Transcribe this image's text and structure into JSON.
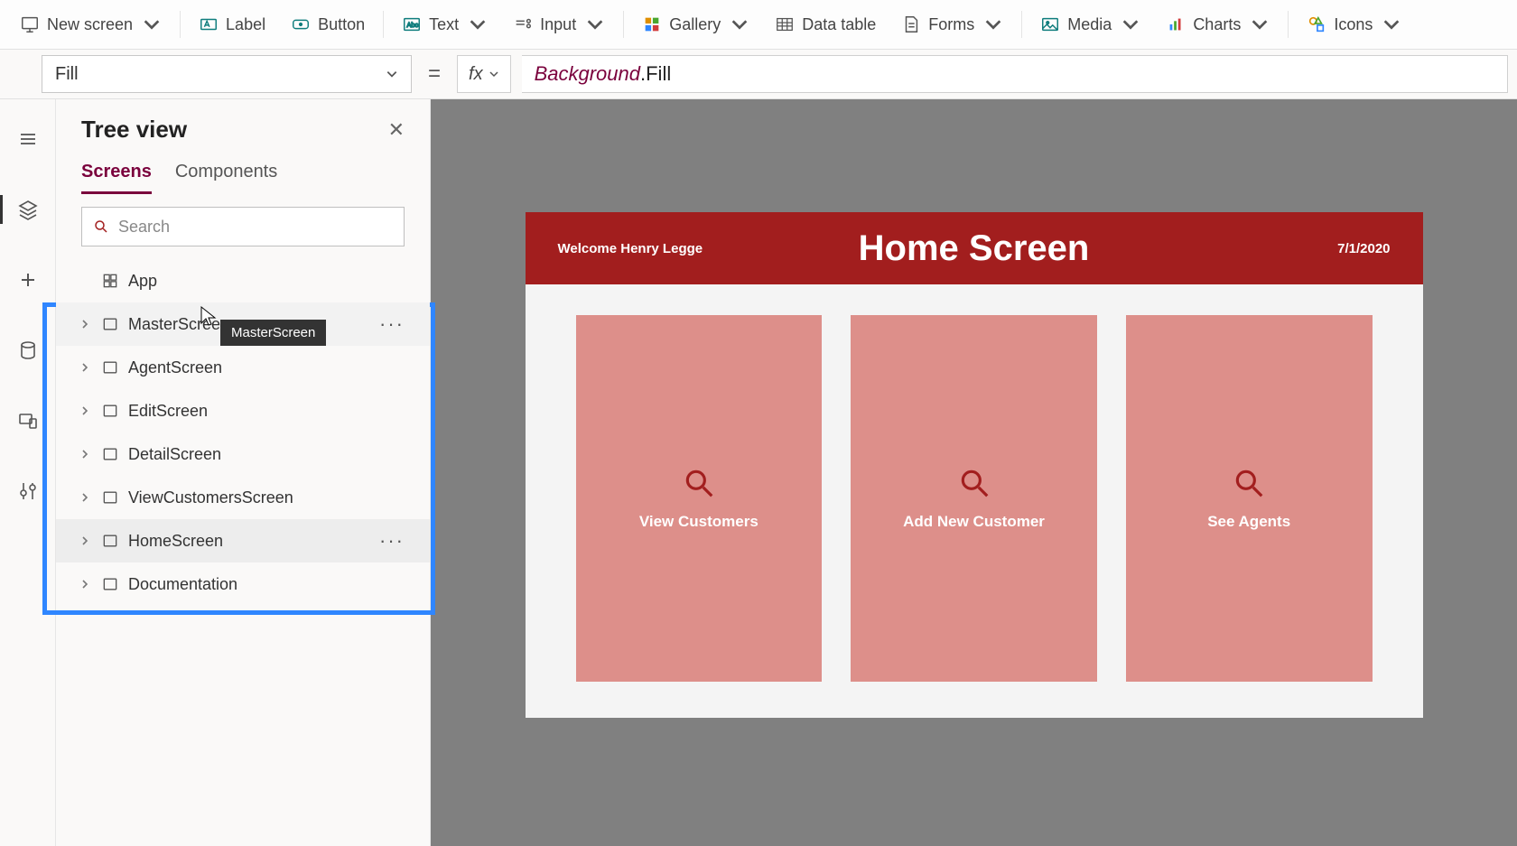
{
  "ribbon": {
    "new_screen": "New screen",
    "label": "Label",
    "button": "Button",
    "text": "Text",
    "input": "Input",
    "gallery": "Gallery",
    "data_table": "Data table",
    "forms": "Forms",
    "media": "Media",
    "charts": "Charts",
    "icons": "Icons"
  },
  "formula": {
    "property": "Fill",
    "fx": "fx",
    "expr_object": "Background",
    "expr_prop": ".Fill"
  },
  "tree": {
    "title": "Tree view",
    "tabs": {
      "screens": "Screens",
      "components": "Components"
    },
    "search_placeholder": "Search",
    "app_label": "App",
    "screens": [
      {
        "name": "MasterScreen",
        "hovered": true,
        "more": true
      },
      {
        "name": "AgentScreen"
      },
      {
        "name": "EditScreen"
      },
      {
        "name": "DetailScreen"
      },
      {
        "name": "ViewCustomersScreen"
      },
      {
        "name": "HomeScreen",
        "selected": true,
        "more": true
      },
      {
        "name": "Documentation"
      }
    ],
    "tooltip": "MasterScreen"
  },
  "app": {
    "welcome": "Welcome Henry Legge",
    "title": "Home Screen",
    "date": "7/1/2020",
    "tiles": [
      {
        "label": "View Customers"
      },
      {
        "label": "Add New Customer"
      },
      {
        "label": "See Agents"
      }
    ]
  }
}
